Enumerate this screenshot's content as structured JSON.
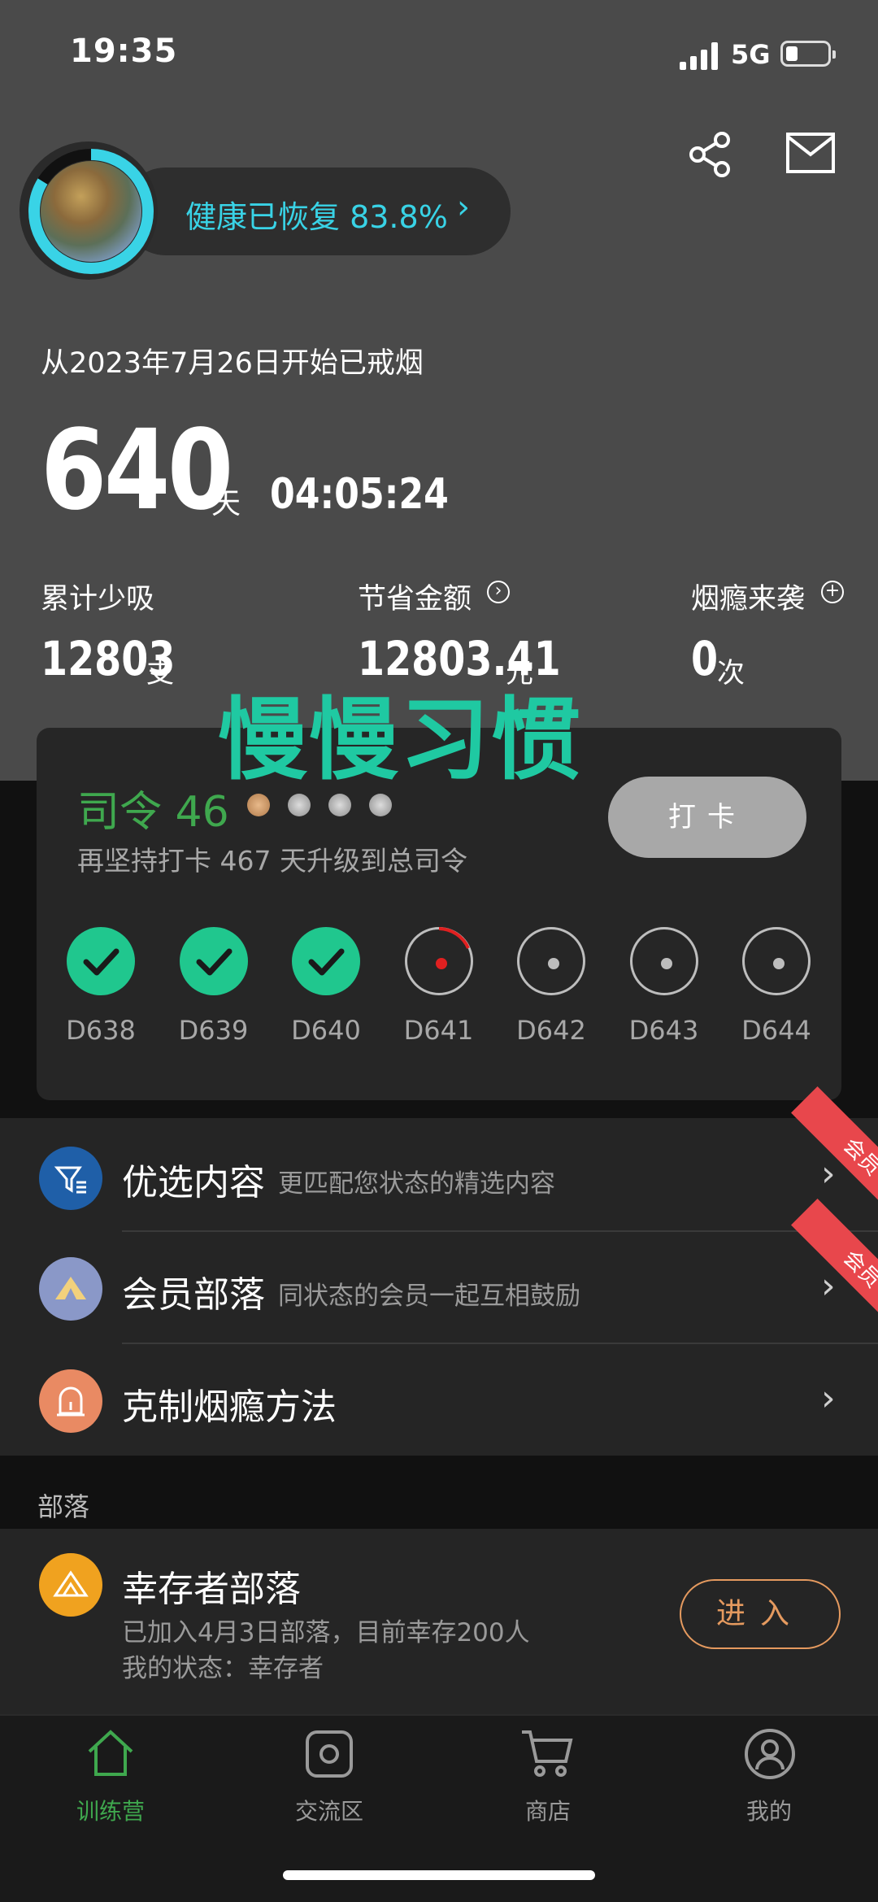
{
  "status_bar": {
    "time": "19:35",
    "network": "5G"
  },
  "header": {
    "health_text": "健康已恢复 83.8%",
    "health_chevron": "›",
    "health_percent": 83.8
  },
  "quit": {
    "since_text": "从2023年7月26日开始已戒烟",
    "days": "640",
    "days_unit": "天",
    "clock": "04:05:24"
  },
  "stats": [
    {
      "label": "累计少吸",
      "value": "12803",
      "unit": "支",
      "icon": ""
    },
    {
      "label": "节省金额",
      "value": "12803.41",
      "unit": "元",
      "icon": "arrow-right-circle-icon"
    },
    {
      "label": "烟瘾来袭",
      "value": "0",
      "unit": "次",
      "icon": "plus-circle-icon"
    }
  ],
  "overlay_text": "慢慢习惯",
  "card": {
    "rank": "司令 46",
    "sub": "再坚持打卡 467 天升级到总司令",
    "button": "打卡",
    "days": [
      {
        "label": "D638",
        "state": "done"
      },
      {
        "label": "D639",
        "state": "done"
      },
      {
        "label": "D640",
        "state": "done"
      },
      {
        "label": "D641",
        "state": "current"
      },
      {
        "label": "D642",
        "state": "todo"
      },
      {
        "label": "D643",
        "state": "todo"
      },
      {
        "label": "D644",
        "state": "todo"
      }
    ]
  },
  "menu": [
    {
      "title": "优选内容",
      "sub": "更匹配您状态的精选内容",
      "badge": "会员",
      "icon": "filter-list-icon",
      "color": "#1f5fa8"
    },
    {
      "title": "会员部落",
      "sub": "同状态的会员一起互相鼓励",
      "badge": "会员",
      "icon": "tent-icon",
      "color": "#8a98c8"
    },
    {
      "title": "克制烟瘾方法",
      "sub": "",
      "badge": "",
      "icon": "alarm-light-icon",
      "color": "#e98a63"
    }
  ],
  "tribe_section": {
    "label": "部落",
    "title": "幸存者部落",
    "line1": "已加入4月3日部落，目前幸存200人",
    "line2": "我的状态：幸存者",
    "button": "进入"
  },
  "tabs": [
    {
      "label": "训练营",
      "icon": "home-icon",
      "active": true
    },
    {
      "label": "交流区",
      "icon": "camera-square-icon",
      "active": false
    },
    {
      "label": "商店",
      "icon": "cart-icon",
      "active": false
    },
    {
      "label": "我的",
      "icon": "user-circle-icon",
      "active": false
    }
  ],
  "colors": {
    "accent_green": "#3fa84e",
    "teal": "#39d3e6",
    "check_green": "#20c78e",
    "member_red": "#e8474c",
    "orange": "#e59a5f"
  }
}
